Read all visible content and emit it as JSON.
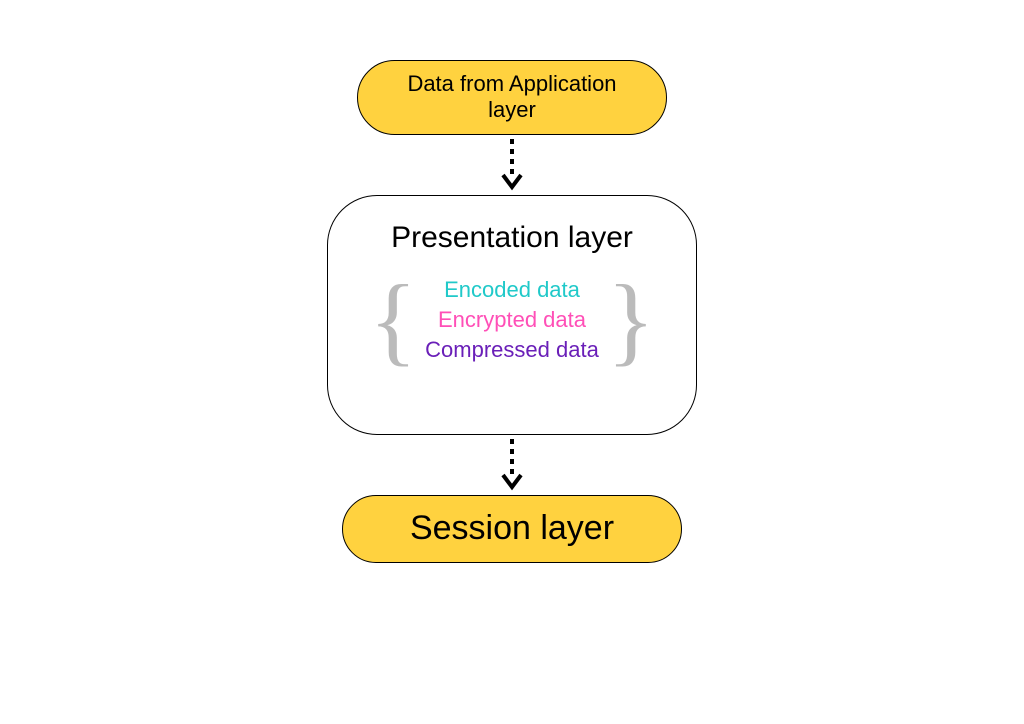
{
  "top": {
    "label": "Data from Application layer"
  },
  "center": {
    "title": "Presentation layer",
    "items": {
      "encoded": "Encoded data",
      "encrypted": "Encrypted data",
      "compressed": "Compressed data"
    }
  },
  "bottom": {
    "label": "Session layer"
  }
}
